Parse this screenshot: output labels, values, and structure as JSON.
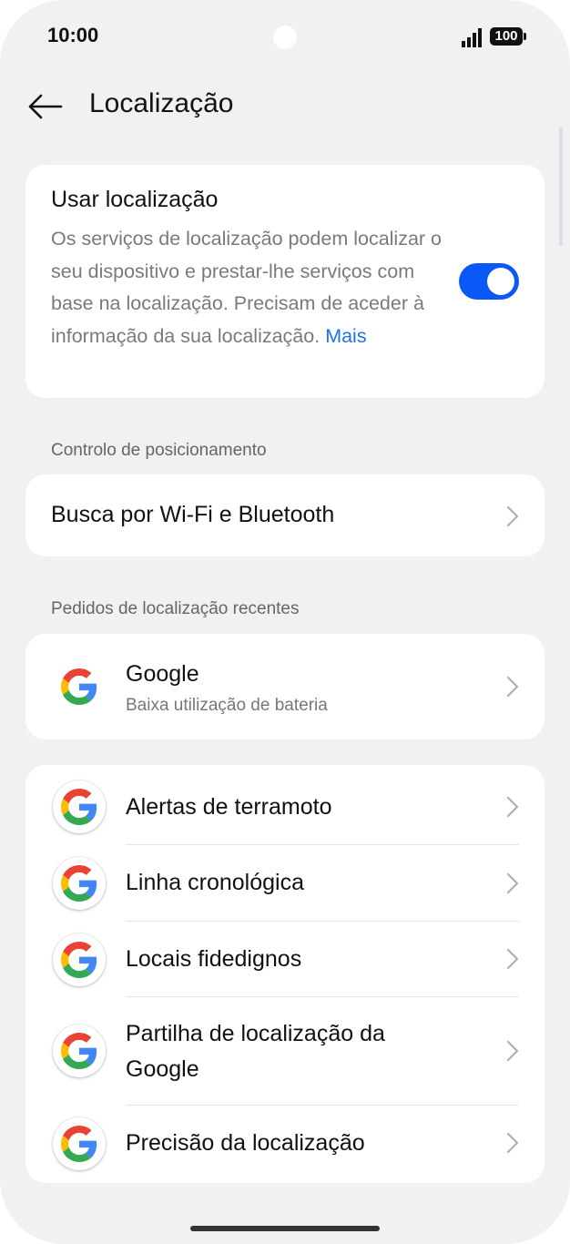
{
  "status_bar": {
    "time": "10:00",
    "battery": "100"
  },
  "header": {
    "title": "Localização",
    "back_icon": "arrow-left-icon"
  },
  "use_location": {
    "title": "Usar localização",
    "description": "Os serviços de localização podem localizar o seu dispositivo e prestar-lhe serviços com base na localização. Precisam de aceder à informação da sua localização.",
    "more_link": "Mais",
    "enabled": true,
    "toggle_color": "#0a59f7"
  },
  "positioning_section": {
    "label": "Controlo de posicionamento",
    "items": [
      {
        "label": "Busca por Wi-Fi e Bluetooth"
      }
    ]
  },
  "recent_requests_section": {
    "label": "Pedidos de localização recentes",
    "items": [
      {
        "title": "Google",
        "subtitle": "Baixa utilização de bateria",
        "icon": "google-icon"
      }
    ]
  },
  "google_services": {
    "items": [
      {
        "label": "Alertas de terramoto",
        "icon": "google-icon"
      },
      {
        "label": "Linha cronológica",
        "icon": "google-icon"
      },
      {
        "label": "Locais fidedignos",
        "icon": "google-icon"
      },
      {
        "label_line1": "Partilha de localização da",
        "label_line2": "Google",
        "icon": "google-icon"
      },
      {
        "label": "Precisão da localização",
        "icon": "google-icon"
      }
    ]
  },
  "colors": {
    "background": "#f0f1f3",
    "card": "#ffffff",
    "accent": "#0a59f7",
    "link": "#1a73e8"
  }
}
